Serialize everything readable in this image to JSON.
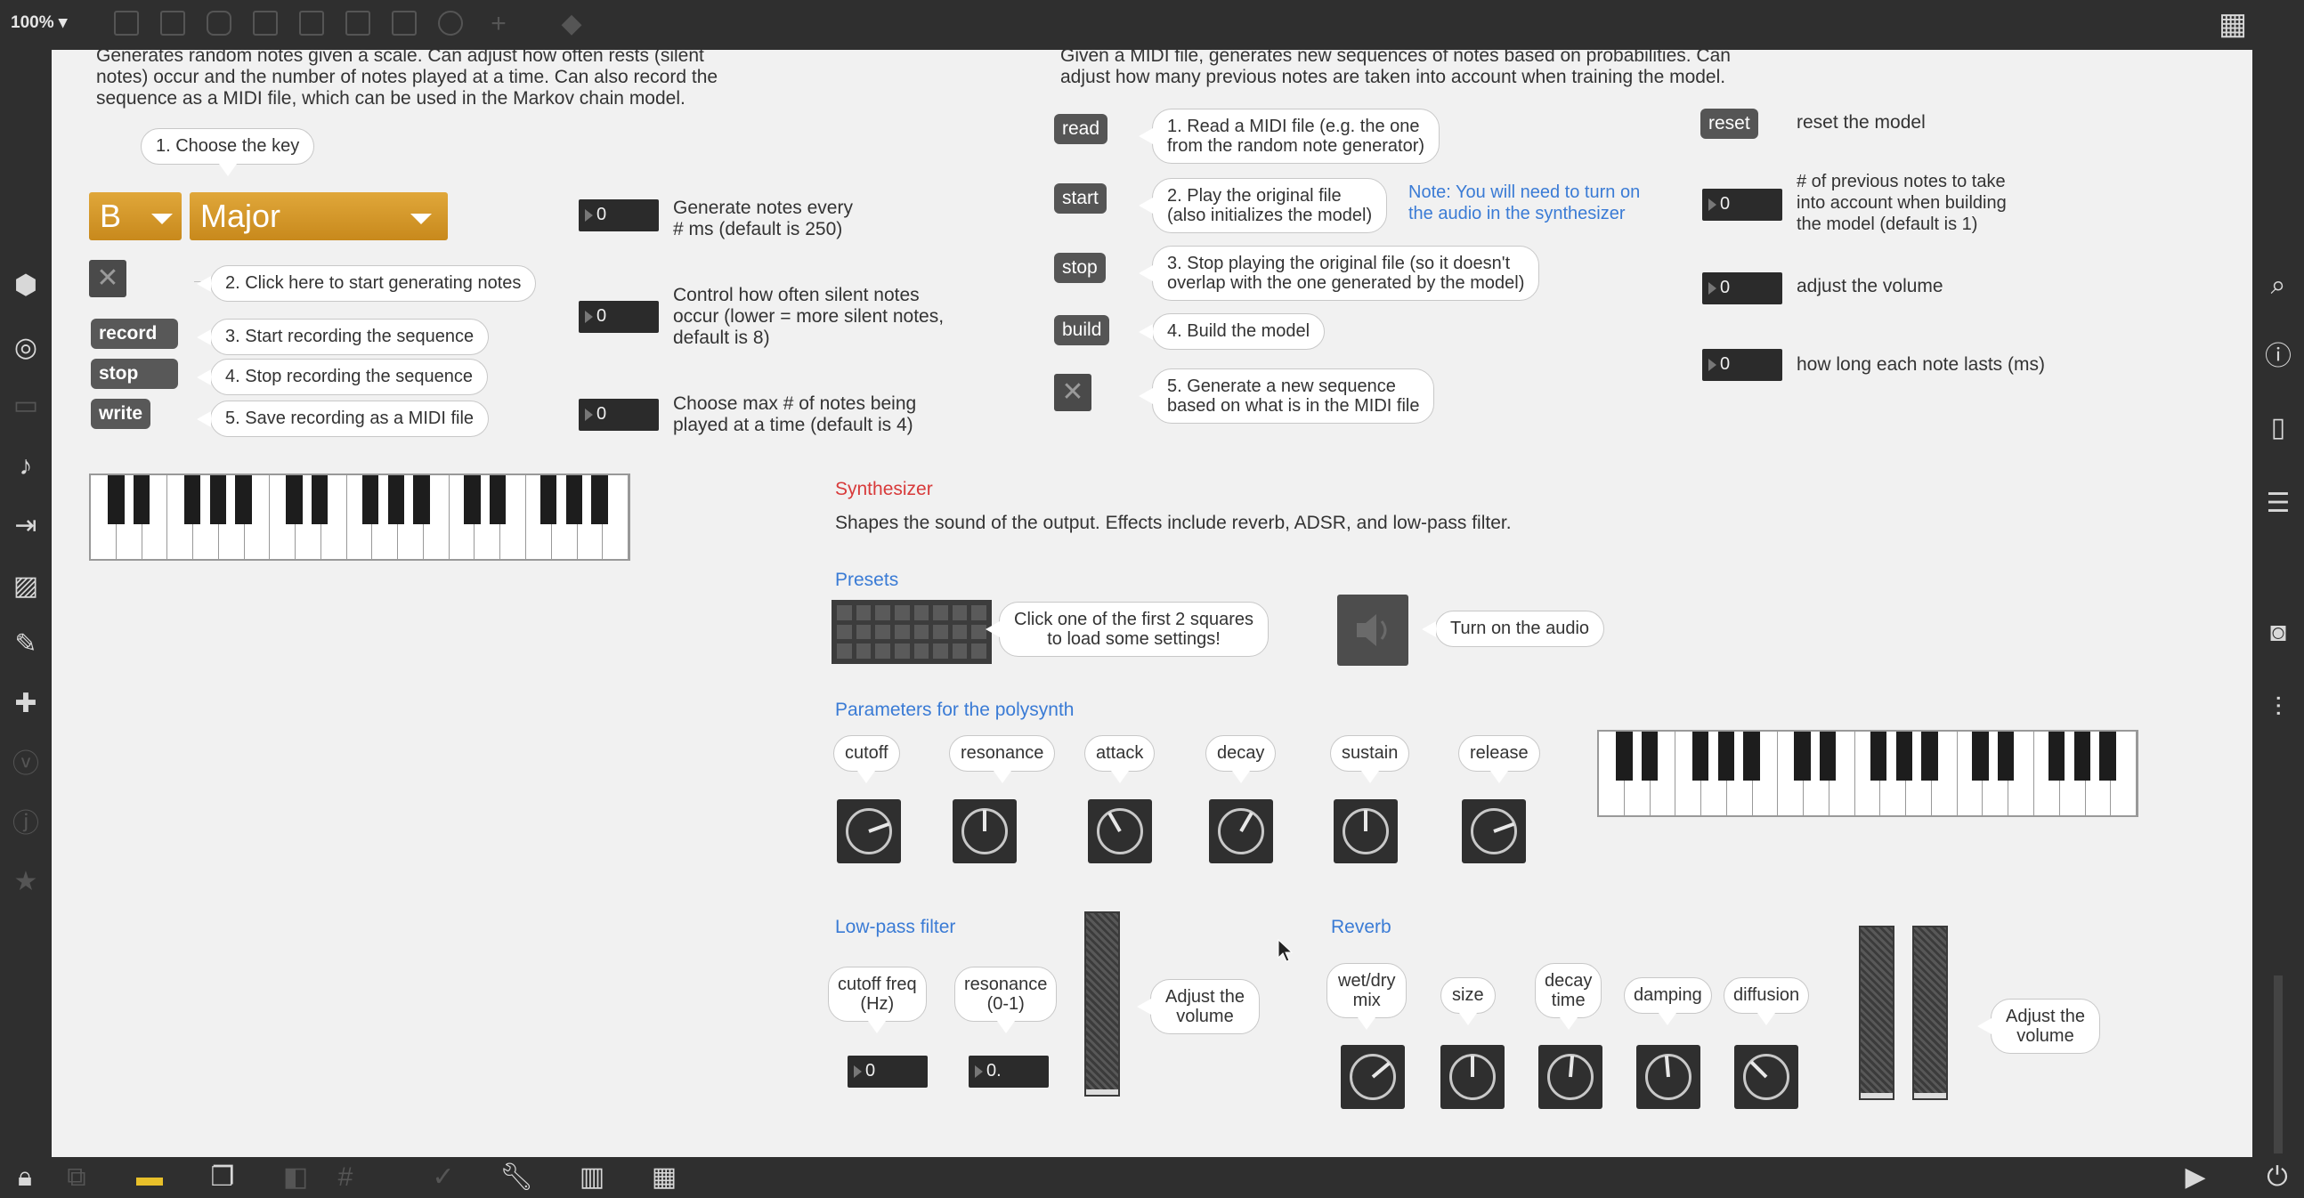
{
  "toolbar": {
    "zoom": "100%"
  },
  "intro": {
    "left": [
      "Generates random notes given a scale. Can adjust how often rests (silent",
      "notes) occur and the number of notes played at a time. Can also record the",
      "sequence as a MIDI file, which can be used in the Markov chain model."
    ],
    "right": [
      "Given a MIDI file, generates new sequences of notes based on probabilities. Can",
      "adjust how many previous notes are taken into account when training the model."
    ]
  },
  "random": {
    "choose_key": "1. Choose the key",
    "key_value": "B",
    "scale_value": "Major",
    "step2": "2. Click here to start generating notes",
    "record_label": "record",
    "step3": "3. Start recording the sequence",
    "stop_label": "stop",
    "step4": "4. Stop recording the sequence",
    "write_label": "write",
    "step5": "5. Save recording as a MIDI file",
    "num1": "0",
    "desc1": [
      "Generate notes every",
      "# ms (default is 250)"
    ],
    "num2": "0",
    "desc2": [
      "Control how often silent notes",
      "occur (lower = more silent notes,",
      "default is 8)"
    ],
    "num3": "0",
    "desc3": [
      "Choose max # of notes being",
      "played at a time (default is 4)"
    ]
  },
  "markov": {
    "read_label": "read",
    "read_text": [
      "1. Read a MIDI file (e.g. the one",
      "from the random note generator)"
    ],
    "start_label": "start",
    "start_text": [
      "2. Play the original file",
      "(also initializes the model)"
    ],
    "note": [
      "Note: You will need to turn on",
      "the audio in the synthesizer"
    ],
    "stop_label": "stop",
    "stop_text": [
      "3. Stop playing the original file (so it doesn't",
      "overlap with the one generated by the model)"
    ],
    "build_label": "build",
    "build_text": "4. Build the model",
    "gen_text": [
      "5. Generate a new sequence",
      "based on what is in the MIDI file"
    ],
    "reset_label": "reset",
    "reset_text": "reset the model",
    "prev_num": "0",
    "prev_text": [
      "# of previous notes to take",
      "into account when building",
      "the model (default is 1)"
    ],
    "vol_num": "0",
    "vol_text": "adjust the volume",
    "len_num": "0",
    "len_text": "how long each note lasts (ms)"
  },
  "synth": {
    "title": "Synthesizer",
    "desc": "Shapes the sound of the output. Effects include reverb, ADSR, and low-pass filter.",
    "presets_title": "Presets",
    "presets_text": [
      "Click one of the first 2 squares",
      "to load some settings!"
    ],
    "audio_text": "Turn on the audio",
    "params_title": "Parameters for the polysynth",
    "params": [
      "cutoff",
      "resonance",
      "attack",
      "decay",
      "sustain",
      "release"
    ],
    "lp_title": "Low-pass filter",
    "lp_cutoff": [
      "cutoff freq",
      "(Hz)"
    ],
    "lp_res": [
      "resonance",
      "(0-1)"
    ],
    "lp_cutoff_val": "0",
    "lp_res_val": "0.",
    "lp_volume": [
      "Adjust the",
      "volume"
    ],
    "reverb_title": "Reverb",
    "reverb_wet": [
      "wet/dry",
      "mix"
    ],
    "reverb_size": "size",
    "reverb_decay": [
      "decay",
      "time"
    ],
    "reverb_damping": "damping",
    "reverb_diffusion": "diffusion",
    "reverb_volume": [
      "Adjust the",
      "volume"
    ]
  }
}
